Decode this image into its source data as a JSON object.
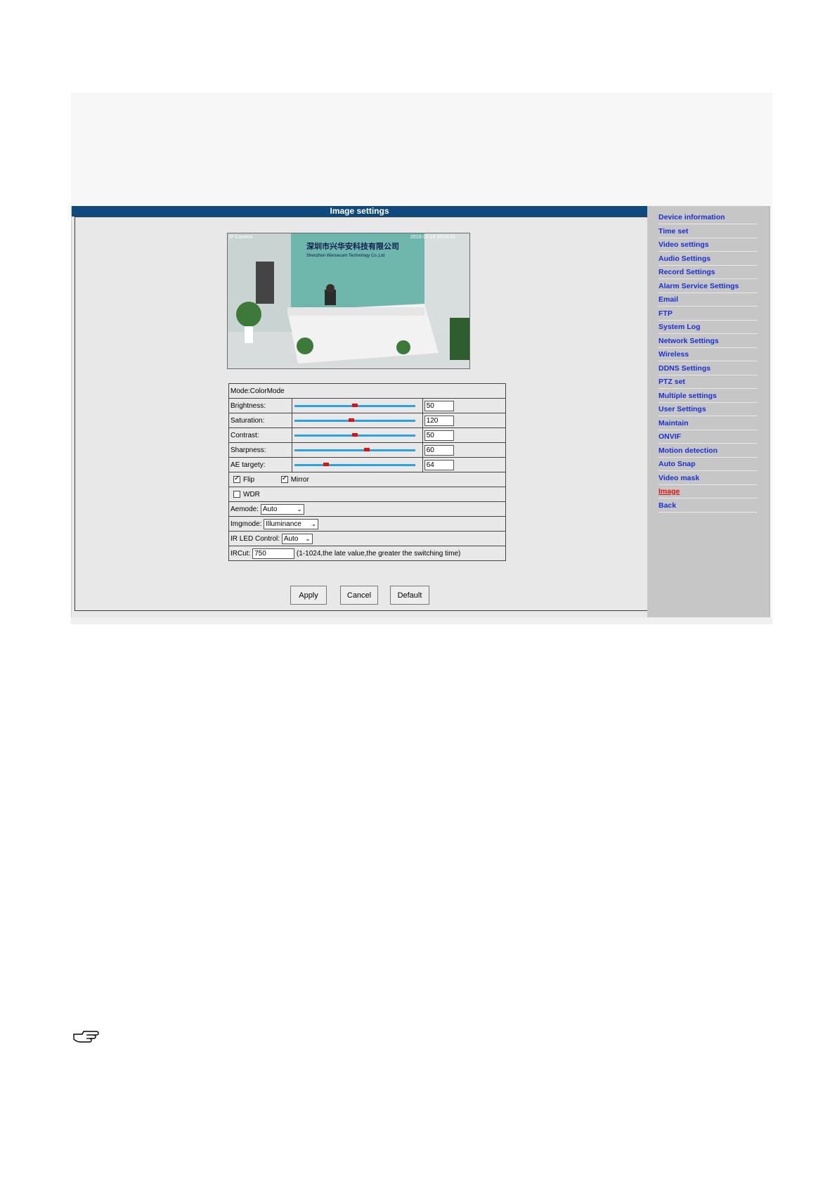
{
  "panel": {
    "title": "Image settings"
  },
  "preview": {
    "osd_left": "IP Camera",
    "osd_right": "2015-11-14 16:04:01",
    "wall_text_cn": "深圳市兴华安科技有限公司",
    "wall_text_en": "Shenzhen Wansecam Technology Co.,Ltd"
  },
  "settings": {
    "mode_label": "Mode:ColorMode",
    "sliders": [
      {
        "label": "Brightness:",
        "value": "50",
        "level": 0.5
      },
      {
        "label": "Saturation:",
        "value": "120",
        "level": 0.47
      },
      {
        "label": "Contrast:",
        "value": "50",
        "level": 0.5
      },
      {
        "label": "Sharpness:",
        "value": "60",
        "level": 0.6
      },
      {
        "label": "AE targety:",
        "value": "64",
        "level": 0.25
      }
    ],
    "flip_label": "Flip",
    "flip_checked": true,
    "mirror_label": "Mirror",
    "mirror_checked": true,
    "wdr_label": "WDR",
    "wdr_checked": false,
    "aemode_label": "Aemode:",
    "aemode_value": "Auto",
    "imgmode_label": "Imgmode:",
    "imgmode_value": "Illuminance",
    "irled_label": "IR LED Control:",
    "irled_value": "Auto",
    "ircut_label": "IRCut:",
    "ircut_value": "750",
    "ircut_hint": "(1-1024,the late value,the greater the switching time)"
  },
  "buttons": {
    "apply": "Apply",
    "cancel": "Cancel",
    "default": "Default"
  },
  "sidebar": {
    "items": [
      {
        "label": "Device information",
        "active": false
      },
      {
        "label": "Time set",
        "active": false
      },
      {
        "label": "Video settings",
        "active": false
      },
      {
        "label": "Audio Settings",
        "active": false
      },
      {
        "label": "Record Settings",
        "active": false
      },
      {
        "label": "Alarm Service Settings",
        "active": false
      },
      {
        "label": "Email",
        "active": false
      },
      {
        "label": "FTP",
        "active": false
      },
      {
        "label": "System Log",
        "active": false
      },
      {
        "label": "Network Settings",
        "active": false
      },
      {
        "label": "Wireless",
        "active": false
      },
      {
        "label": "DDNS Settings",
        "active": false
      },
      {
        "label": "PTZ set",
        "active": false
      },
      {
        "label": "Multiple settings",
        "active": false
      },
      {
        "label": "User Settings",
        "active": false
      },
      {
        "label": "Maintain",
        "active": false
      },
      {
        "label": "ONVIF",
        "active": false
      },
      {
        "label": "Motion detection",
        "active": false
      },
      {
        "label": "Auto Snap",
        "active": false
      },
      {
        "label": "Video mask",
        "active": false
      },
      {
        "label": "Image",
        "active": true
      },
      {
        "label": "Back",
        "active": false
      }
    ]
  },
  "colors": {
    "title_bar": "#0e4a7e",
    "link": "#1a2fd6",
    "active_link": "#e01010",
    "slider_track": "#2ba3e0",
    "slider_knob": "#e01010"
  },
  "icons": {
    "note": "pointing-hand-icon"
  }
}
